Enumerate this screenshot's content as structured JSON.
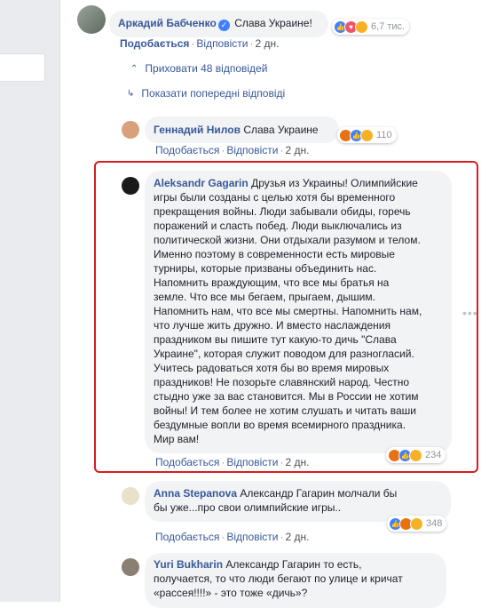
{
  "comment_top": {
    "author": "Аркадий Бабченко",
    "text": "Слава Украине!",
    "reaction_count": "6,7 тис.",
    "like": "Подобається",
    "reply": "Відповісти",
    "time": "2 дн."
  },
  "hide_replies": "Приховати 48 відповідей",
  "show_previous": "Показати попередні відповіді",
  "reply1": {
    "author": "Геннадий Нилов",
    "text": "Слава Украине",
    "reaction_count": "110",
    "like": "Подобається",
    "reply": "Відповісти",
    "time": "2 дн."
  },
  "reply2": {
    "author": "Aleksandr Gagarin",
    "lines": [
      "Друзья из Украины! Олимпийские",
      "игры были созданы с целью хотя бы временного",
      "прекращения войны. Люди забывали обиды, горечь",
      "поражений и сласть побед. Люди выключались из",
      "политической жизни. Они отдыхали разумом и телом.",
      "Именно поэтому в современности есть мировые",
      "турниры, которые призваны объединить нас.",
      "Напомнить враждующим, что все мы братья на",
      "земле. Что все мы бегаем, прыгаем, дышим.",
      "Напомнить нам, что все мы смертны. Напомнить нам,",
      "что лучше жить дружно. И вместо наслаждения",
      "праздником вы пишите тут какую-то дичь \"Слава",
      "Украине\", которая служит поводом для разногласий.",
      "Учитесь радоваться хотя бы во время мировых",
      "праздников! Не позорьте славянский народ. Честно",
      "стыдно уже за вас становится. Мы в России не хотим",
      "войны! И тем более не хотим слушать и читать ваши",
      "бездумные вопли во время всемирного праздника.",
      "Мир вам!"
    ],
    "reaction_count": "234",
    "like": "Подобається",
    "reply": "Відповісти",
    "time": "2 дн."
  },
  "reply3": {
    "author": "Anna Stepanova",
    "line1": "Александр Гагарин молчали бы",
    "line2": "бы уже...про свои олимпийские игры..",
    "reaction_count": "348",
    "like": "Подобається",
    "reply": "Відповісти",
    "time": "2 дн."
  },
  "reply4": {
    "author": "Yuri Bukharin",
    "line1": "Александр Гагарин то есть,",
    "line2": "получается, то что люди бегают по улице и кричат",
    "line3": "«рассея!!!!» - это тоже «дичь»?"
  },
  "colors": {
    "link": "#385898",
    "bubble": "#f2f3f5",
    "highlight": "#d81d20"
  },
  "icons": [
    "verified-icon",
    "collapse-arrow-icon",
    "expand-reply-arrow-icon",
    "more-options-icon"
  ]
}
